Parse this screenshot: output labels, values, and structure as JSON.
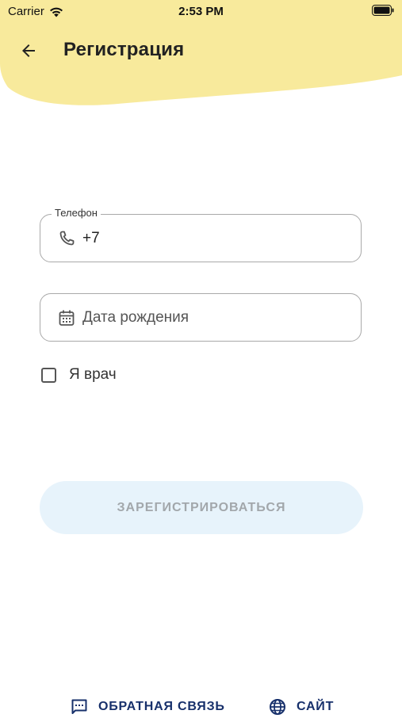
{
  "status_bar": {
    "carrier": "Carrier",
    "time": "2:53 PM"
  },
  "app_bar": {
    "title": "Регистрация"
  },
  "form": {
    "phone": {
      "label": "Телефон",
      "value": "+7"
    },
    "birth_date": {
      "placeholder": "Дата рождения"
    },
    "doctor_checkbox": {
      "label": "Я врач",
      "checked": false
    },
    "register_button": {
      "label": "ЗАРЕГИСТРИРОВАТЬСЯ",
      "enabled": false
    }
  },
  "footer": {
    "feedback_label": "ОБРАТНАЯ СВЯЗЬ",
    "site_label": "САЙТ"
  },
  "colors": {
    "header_yellow": "#f8ea9c",
    "footer_link": "#17306b",
    "button_disabled_bg": "#e7f3fb",
    "button_disabled_text": "#a2a7ab"
  },
  "icons": {
    "back": "arrow-left-icon",
    "phone": "phone-icon",
    "calendar": "calendar-icon",
    "feedback": "message-icon",
    "site": "globe-icon"
  }
}
